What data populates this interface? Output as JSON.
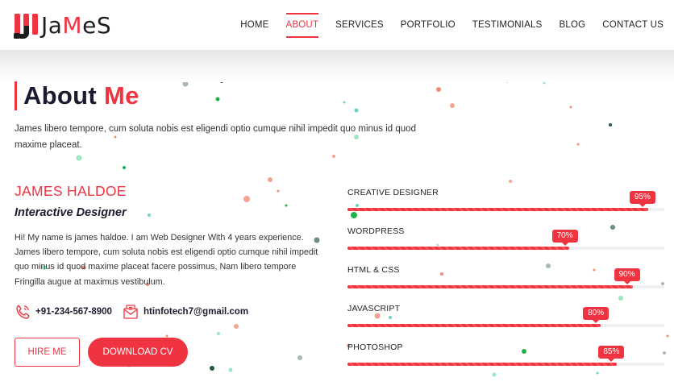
{
  "brand": {
    "logo_text_1": "Ja",
    "logo_text_2": "M",
    "logo_text_3": "eS",
    "accent_color": "#ef3340"
  },
  "nav": {
    "items": [
      {
        "label": "HOME",
        "active": false
      },
      {
        "label": "ABOUT",
        "active": true
      },
      {
        "label": "SERVICES",
        "active": false
      },
      {
        "label": "PORTFOLIO",
        "active": false
      },
      {
        "label": "TESTIMONIALS",
        "active": false
      },
      {
        "label": "BLOG",
        "active": false
      },
      {
        "label": "CONTACT US",
        "active": false
      }
    ]
  },
  "about": {
    "title_1": "About",
    "title_2": "Me",
    "intro": "James libero tempore, cum soluta nobis est eligendi optio cumque nihil impedit quo minus id quod maxime placeat.",
    "name": "JAMES HALDOE",
    "role": "Interactive Designer",
    "bio": "Hi! My name is james haldoe. I am Web Designer With 4 years experience. James libero tempore, cum soluta nobis est eligendi optio cumque nihil impedit quo minus id quod maxime placeat facere possimus, Nam libero tempore Fringilla augue at maximus vestibulum.",
    "phone": "+91-234-567-8900",
    "email": "htinfotech7@gmail.com",
    "phone_icon": "phone-icon",
    "email_icon": "envelope-icon",
    "hire_label": "HIRE ME",
    "download_label": "DOWNLOAD CV"
  },
  "skills": [
    {
      "name": "CREATIVE DESIGNER",
      "value": 95,
      "label": "95%"
    },
    {
      "name": "WORDPRESS",
      "value": 70,
      "label": "70%"
    },
    {
      "name": "HTML & CSS",
      "value": 90,
      "label": "90%"
    },
    {
      "name": "JAVASCRIPT",
      "value": 80,
      "label": "80%"
    },
    {
      "name": "PHOTOSHOP",
      "value": 85,
      "label": "85%"
    }
  ]
}
